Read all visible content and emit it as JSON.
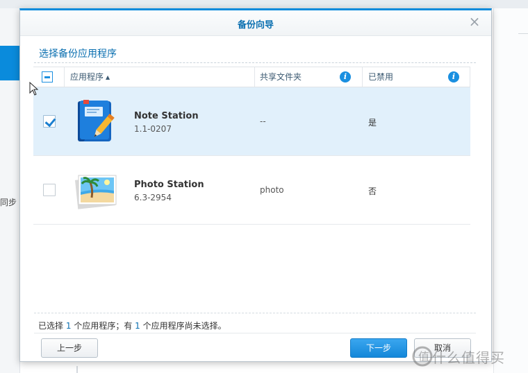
{
  "dialog": {
    "title": "备份向导",
    "section_title": "选择备份应用程序"
  },
  "background": {
    "sidebar_label": "同步"
  },
  "table": {
    "columns": [
      {
        "label": "应用程序",
        "sorted": "ascending"
      },
      {
        "label": "共享文件夹",
        "info": true
      },
      {
        "label": "已禁用",
        "info": true
      }
    ],
    "rows": [
      {
        "checked": true,
        "icon": "note-station-icon",
        "name": "Note Station",
        "version": "1.1-0207",
        "shared_folder": "--",
        "disabled": "是"
      },
      {
        "checked": false,
        "icon": "photo-station-icon",
        "name": "Photo Station",
        "version": "6.3-2954",
        "shared_folder": "photo",
        "disabled": "否"
      }
    ]
  },
  "status": {
    "prefix": "已选择",
    "selected_count": "1",
    "middle": "个应用程序；有",
    "unselected_count": "1",
    "suffix": "个应用程序尚未选择。"
  },
  "buttons": {
    "prev": "上一步",
    "next": "下一步",
    "cancel": "取消"
  },
  "watermark": "什么值得买",
  "colors": {
    "accent": "#0a8bdc",
    "title_blue": "#0a6fb0",
    "selected_row": "#e1f0fb"
  }
}
